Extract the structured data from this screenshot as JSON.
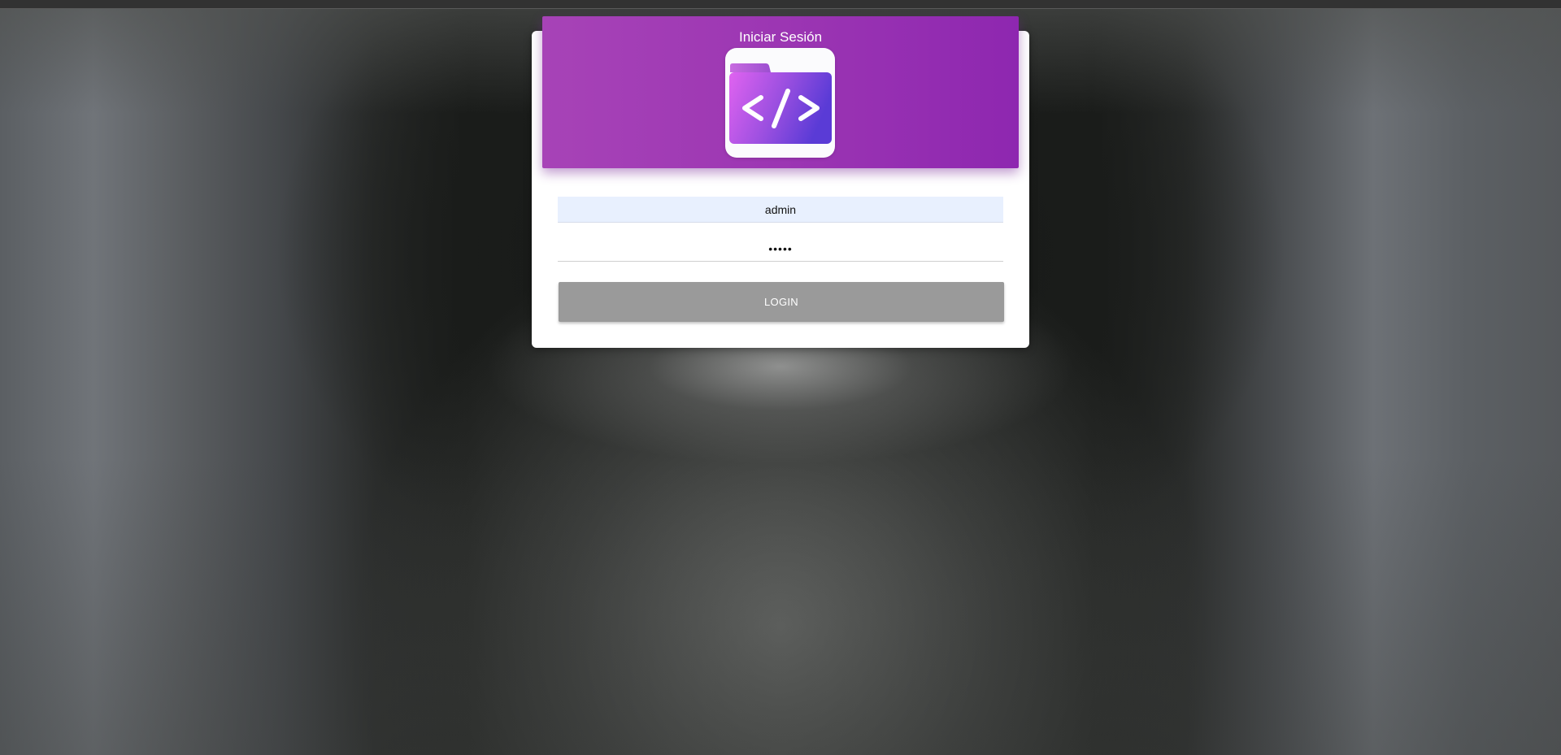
{
  "login": {
    "title": "Iniciar Sesión",
    "logo_icon": "code-folder-icon",
    "username": {
      "value": "admin"
    },
    "password": {
      "value": "admin"
    },
    "submit_label": "LOGIN"
  },
  "colors": {
    "header_purple": "#9c36b3",
    "button_gray": "#9a9a9a",
    "autofill_blue": "#e8f0fe"
  }
}
